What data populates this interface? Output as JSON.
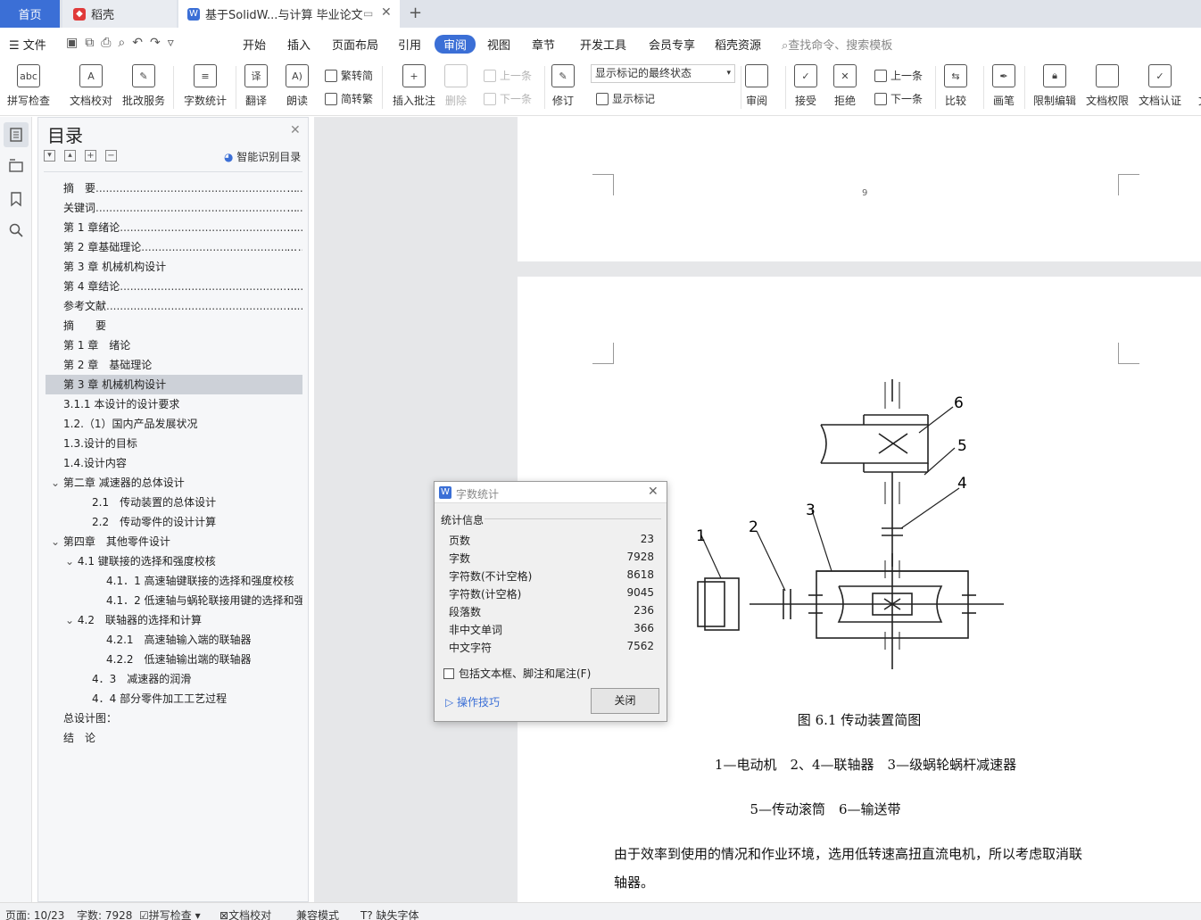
{
  "tabs": {
    "home": "首页",
    "daoke": "稻壳",
    "document": "基于SolidW...与计算 毕业论文"
  },
  "menu": {
    "file": "文件",
    "items": [
      "开始",
      "插入",
      "页面布局",
      "引用",
      "审阅",
      "视图",
      "章节",
      "开发工具",
      "会员专享",
      "稻壳资源"
    ],
    "active": "审阅",
    "search_placeholder": "查找命令、搜索模板"
  },
  "ribbon": {
    "spell": "拼写检查",
    "doc_check": "文档校对",
    "batch": "批改服务",
    "word_count": "字数统计",
    "translate": "翻译",
    "read": "朗读",
    "to_trad": "繁转简",
    "to_simp": "简转繁",
    "insert_comment": "插入批注",
    "delete": "删除",
    "prev_item": "上一条",
    "next_item": "下一条",
    "revise": "修订",
    "markup_state": "显示标记的最终状态",
    "show_markup": "显示标记",
    "review": "审阅",
    "accept": "接受",
    "reject": "拒绝",
    "prev": "上一条",
    "next": "下一条",
    "compare": "比较",
    "pen": "画笔",
    "restrict": "限制编辑",
    "permission": "文档权限",
    "certify": "文档认证",
    "more": "文"
  },
  "nav": {
    "title": "目录",
    "smart": "智能识别目录",
    "items": [
      {
        "text": "摘　要",
        "dots": true,
        "indent": 0
      },
      {
        "text": "关键词",
        "dots": true,
        "indent": 0
      },
      {
        "text": "第 1 章绪论",
        "dots": true,
        "indent": 0
      },
      {
        "text": "第 2 章基础理论",
        "dots": true,
        "indent": 0
      },
      {
        "text": "第 3 章  机械机构设计",
        "dots": false,
        "indent": 0
      },
      {
        "text": "第 4 章结论",
        "dots": true,
        "indent": 0
      },
      {
        "text": "参考文献",
        "dots": true,
        "indent": 0
      },
      {
        "text": "摘　　要",
        "indent": 0
      },
      {
        "text": "第 1 章　绪论",
        "indent": 0
      },
      {
        "text": "第 2 章　基础理论",
        "indent": 0
      },
      {
        "text": "第 3 章  机械机构设计",
        "indent": 0,
        "selected": true
      },
      {
        "text": "3.1.1  本设计的设计要求",
        "indent": 0
      },
      {
        "text": "1.2.（1）国内产品发展状况",
        "indent": 0
      },
      {
        "text": "1.3.设计的目标",
        "indent": 0
      },
      {
        "text": "1.4.设计内容",
        "indent": 0
      },
      {
        "text": "第二章  减速器的总体设计",
        "indent": 0,
        "arrow": true
      },
      {
        "text": "2.1　传动装置的总体设计",
        "indent": 2
      },
      {
        "text": "2.2　传动零件的设计计算",
        "indent": 2
      },
      {
        "text": "第四章　其他零件设计",
        "indent": 0,
        "arrow": true
      },
      {
        "text": "4.1 键联接的选择和强度校核",
        "indent": 1,
        "arrow": true
      },
      {
        "text": "4.1．1 高速轴键联接的选择和强度校核",
        "indent": 3
      },
      {
        "text": "4.1．2  低速轴与蜗轮联接用键的选择和强度校核",
        "indent": 3
      },
      {
        "text": "4.2　联轴器的选择和计算",
        "indent": 1,
        "arrow": true
      },
      {
        "text": "4.2.1　高速轴输入端的联轴器",
        "indent": 3
      },
      {
        "text": "4.2.2　低速轴输出端的联轴器",
        "indent": 3
      },
      {
        "text": "4．3　减速器的润滑",
        "indent": 2
      },
      {
        "text": "4．4  部分零件加工工艺过程",
        "indent": 2
      },
      {
        "text": "总设计图：",
        "indent": 0
      },
      {
        "text": "结　论",
        "indent": 0
      }
    ]
  },
  "doc": {
    "page_number": "9",
    "figure_caption": "图 6.1 传动装置简图",
    "legend_line1": "1—电动机　2、4—联轴器　3—级蜗轮蜗杆减速器",
    "legend_line2": "5—传动滚筒　6—输送带",
    "body_line1": "由于效率到使用的情况和作业环境，选用低转速高扭直流电机，所以考虑取消联",
    "body_line2": "轴器。",
    "labels": [
      "1",
      "2",
      "3",
      "4",
      "5",
      "6"
    ]
  },
  "dialog": {
    "title": "字数统计",
    "section": "统计信息",
    "rows": [
      {
        "label": "页数",
        "value": "23"
      },
      {
        "label": "字数",
        "value": "7928"
      },
      {
        "label": "字符数(不计空格)",
        "value": "8618"
      },
      {
        "label": "字符数(计空格)",
        "value": "9045"
      },
      {
        "label": "段落数",
        "value": "236"
      },
      {
        "label": "非中文单词",
        "value": "366"
      },
      {
        "label": "中文字符",
        "value": "7562"
      }
    ],
    "include": "包括文本框、脚注和尾注(F)",
    "tips": "操作技巧",
    "close": "关闭"
  },
  "status": {
    "page": "页面: 10/23",
    "words": "字数: 7928",
    "spell": "拼写检查",
    "proof": "文档校对",
    "compat": "兼容模式",
    "missing_font": "缺失字体"
  },
  "colors": {
    "accent": "#3b6fd6",
    "daoke": "#e03a3a"
  }
}
